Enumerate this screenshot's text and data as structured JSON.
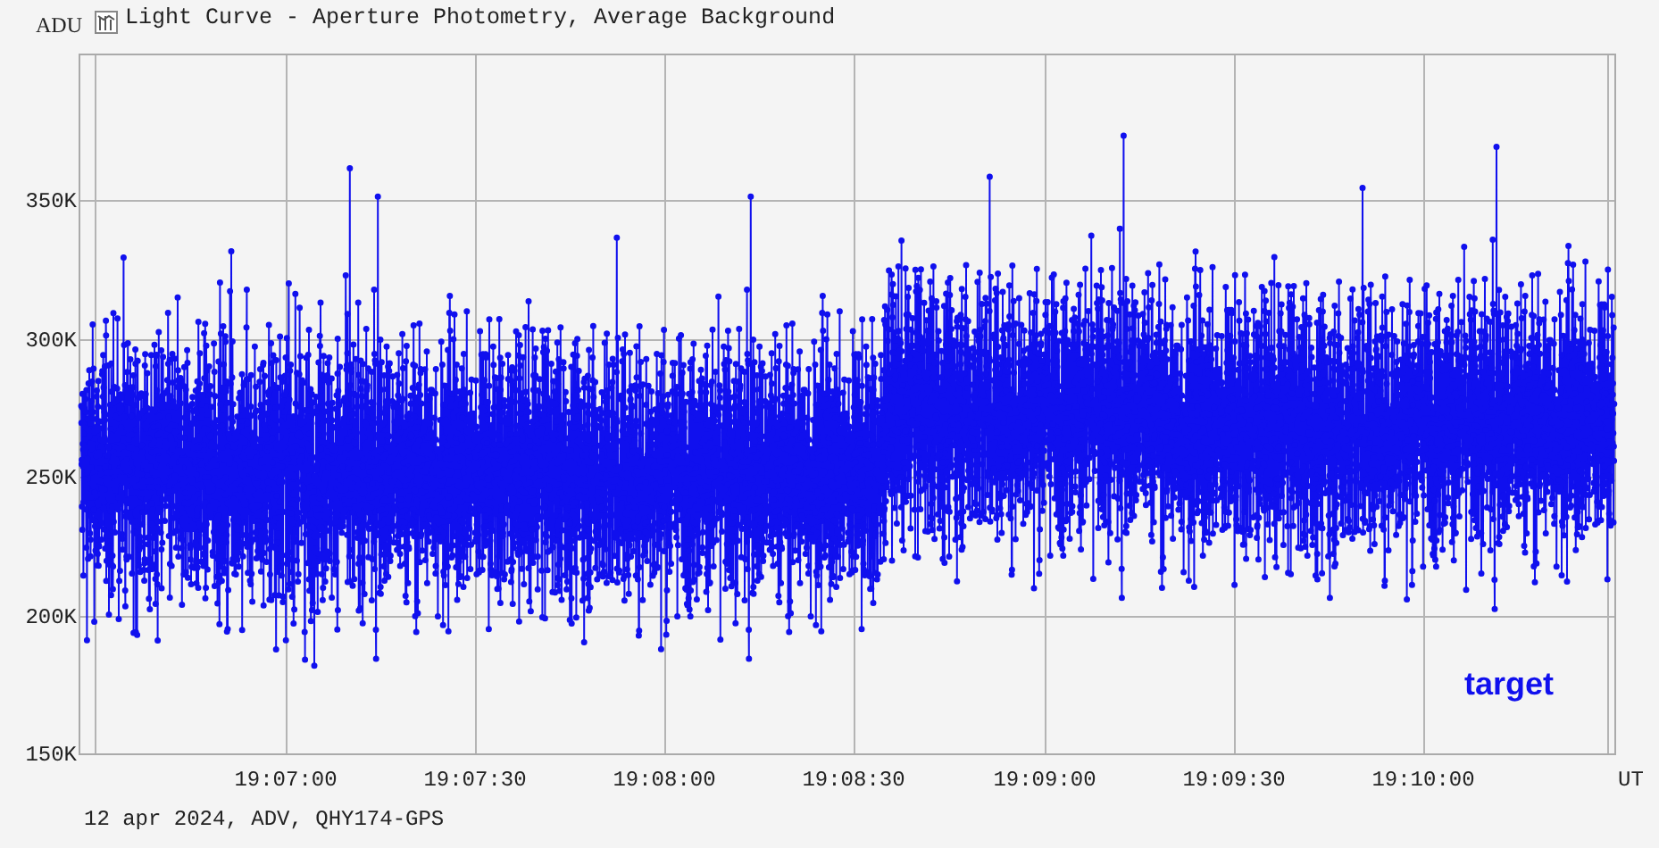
{
  "window": {
    "title": "Light Curve - Aperture Photometry, Average Background"
  },
  "plot": {
    "y_axis_label": "ADU",
    "x_axis_unit": "UT",
    "y_tick_labels": [
      "350K",
      "300K",
      "250K",
      "200K",
      "150K"
    ],
    "x_tick_labels": [
      "19:07:00",
      "19:07:30",
      "19:08:00",
      "19:08:30",
      "19:09:00",
      "19:09:30",
      "19:10:00"
    ],
    "series_label": "target"
  },
  "footer": "12 apr 2024, ADV, QHY174-GPS"
}
